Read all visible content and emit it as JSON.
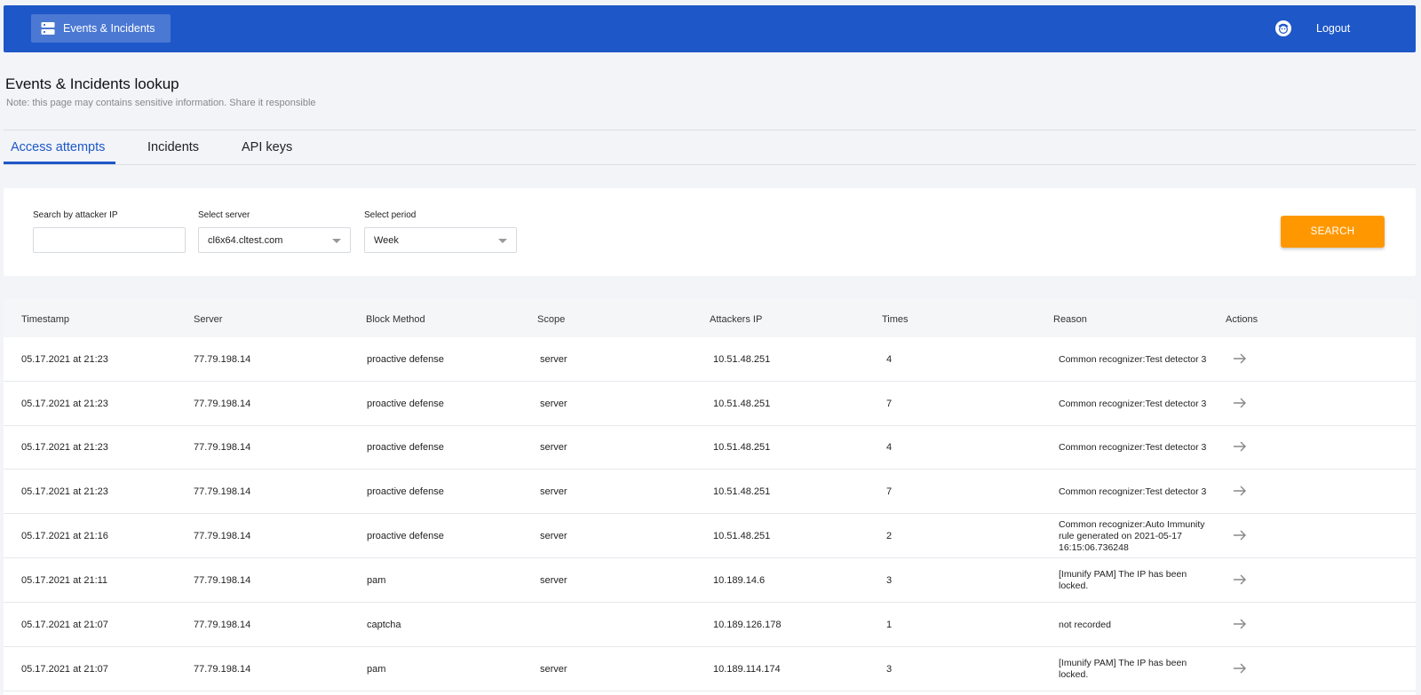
{
  "header": {
    "brand_label": "Events & Incidents",
    "logout_label": "Logout",
    "brand_color": "#1e57c8"
  },
  "page": {
    "title": "Events & Incidents lookup",
    "note": "Note: this page may contains sensitive information. Share it responsible"
  },
  "tabs": [
    {
      "label": "Access attempts",
      "active": true
    },
    {
      "label": "Incidents",
      "active": false
    },
    {
      "label": "API keys",
      "active": false
    }
  ],
  "filters": {
    "ip_label": "Search by attacker IP",
    "ip_value": "",
    "server_label": "Select server",
    "server_value": "cl6x64.cltest.com",
    "period_label": "Select period",
    "period_value": "Week",
    "search_label": "SEARCH",
    "search_color": "#ff9800"
  },
  "table": {
    "columns": [
      "Timestamp",
      "Server",
      "Block Method",
      "Scope",
      "Attackers IP",
      "Times",
      "Reason",
      "Actions"
    ],
    "rows": [
      {
        "timestamp": "05.17.2021 at 21:23",
        "server": "77.79.198.14",
        "method": "proactive defense",
        "scope": "server",
        "ip": "10.51.48.251",
        "times": "4",
        "reason": "Common recognizer:Test detector 3"
      },
      {
        "timestamp": "05.17.2021 at 21:23",
        "server": "77.79.198.14",
        "method": "proactive defense",
        "scope": "server",
        "ip": "10.51.48.251",
        "times": "7",
        "reason": "Common recognizer:Test detector 3"
      },
      {
        "timestamp": "05.17.2021 at 21:23",
        "server": "77.79.198.14",
        "method": "proactive defense",
        "scope": "server",
        "ip": "10.51.48.251",
        "times": "4",
        "reason": "Common recognizer:Test detector 3"
      },
      {
        "timestamp": "05.17.2021 at 21:23",
        "server": "77.79.198.14",
        "method": "proactive defense",
        "scope": "server",
        "ip": "10.51.48.251",
        "times": "7",
        "reason": "Common recognizer:Test detector 3"
      },
      {
        "timestamp": "05.17.2021 at 21:16",
        "server": "77.79.198.14",
        "method": "proactive defense",
        "scope": "server",
        "ip": "10.51.48.251",
        "times": "2",
        "reason": "Common recognizer:Auto Immunity rule generated on 2021-05-17 16:15:06.736248"
      },
      {
        "timestamp": "05.17.2021 at 21:11",
        "server": "77.79.198.14",
        "method": "pam",
        "scope": "server",
        "ip": "10.189.14.6",
        "times": "3",
        "reason": "[Imunify PAM] The IP has been locked."
      },
      {
        "timestamp": "05.17.2021 at 21:07",
        "server": "77.79.198.14",
        "method": "captcha",
        "scope": "",
        "ip": "10.189.126.178",
        "times": "1",
        "reason": "not recorded"
      },
      {
        "timestamp": "05.17.2021 at 21:07",
        "server": "77.79.198.14",
        "method": "pam",
        "scope": "server",
        "ip": "10.189.114.174",
        "times": "3",
        "reason": "[Imunify PAM] The IP has been locked."
      }
    ]
  }
}
